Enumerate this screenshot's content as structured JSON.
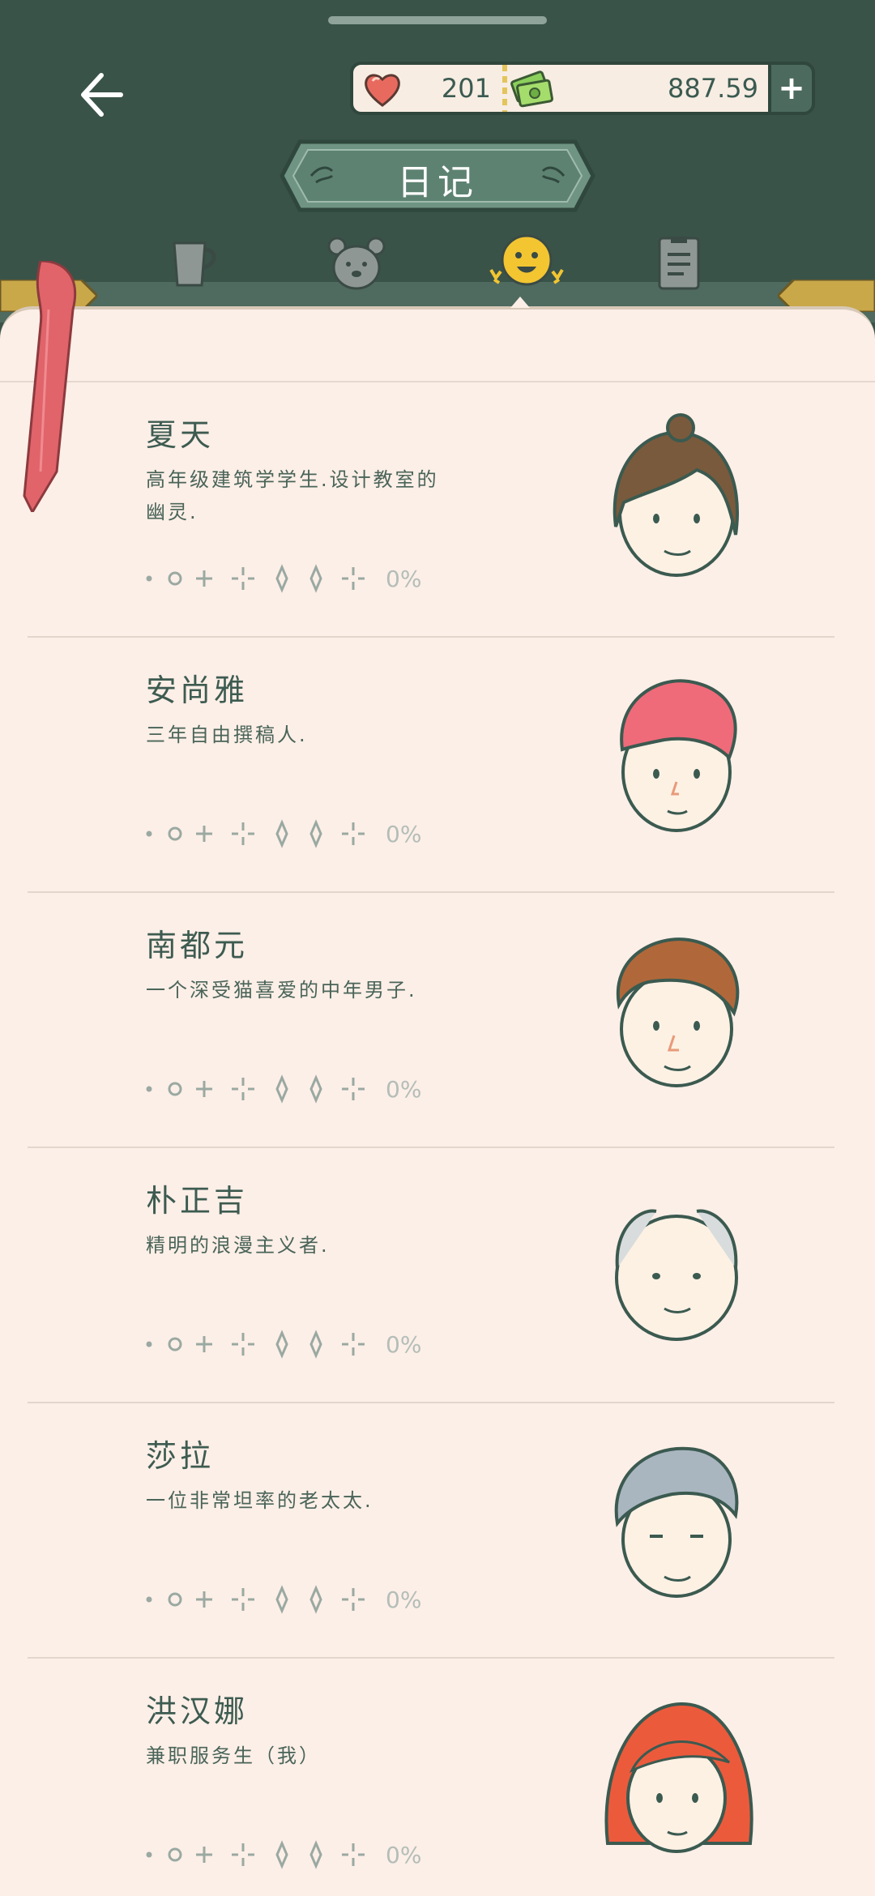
{
  "header": {
    "title": "日记",
    "hearts": "201",
    "money": "887.59",
    "plus_label": "+"
  },
  "tabs": [
    {
      "id": "cup",
      "icon": "cup-icon",
      "active": false
    },
    {
      "id": "bear",
      "icon": "bear-icon",
      "active": false
    },
    {
      "id": "smile",
      "icon": "smiley-icon",
      "active": true
    },
    {
      "id": "notes",
      "icon": "notes-icon",
      "active": false
    }
  ],
  "characters": [
    {
      "name": "夏天",
      "desc_line1": "高年级建筑学学生.设计教室的",
      "desc_line2": "幽灵.",
      "progress": "0%",
      "hair": "#7a5a3c"
    },
    {
      "name": "安尚雅",
      "desc_line1": "三年自由撰稿人.",
      "desc_line2": "",
      "progress": "0%",
      "hair": "#ef6b7a"
    },
    {
      "name": "南都元",
      "desc_line1": "一个深受猫喜爱的中年男子.",
      "desc_line2": "",
      "progress": "0%",
      "hair": "#b0683a"
    },
    {
      "name": "朴正吉",
      "desc_line1": "精明的浪漫主义者.",
      "desc_line2": "",
      "progress": "0%",
      "hair": "#d8dcdc"
    },
    {
      "name": "莎拉",
      "desc_line1": "一位非常坦率的老太太.",
      "desc_line2": "",
      "progress": "0%",
      "hair": "#a9b6c0"
    },
    {
      "name": "洪汉娜",
      "desc_line1": "兼职服务生（我）",
      "desc_line2": "",
      "progress": "0%",
      "hair": "#ec5a3c"
    }
  ],
  "colors": {
    "background": "#3a5349",
    "page": "#fcefe7",
    "accent": "#4c6a5d",
    "ribbon": "#e0646a"
  }
}
